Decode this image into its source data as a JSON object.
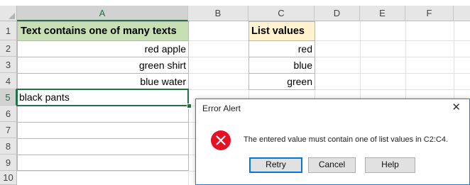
{
  "columns": [
    "A",
    "B",
    "C",
    "D",
    "E",
    "F"
  ],
  "rows": [
    "1",
    "2",
    "3",
    "4",
    "5",
    "6",
    "7",
    "8",
    "9",
    "10"
  ],
  "cells": {
    "A1": "Text contains one of many texts",
    "A2": "red apple",
    "A3": "green shirt",
    "A4": "blue water",
    "A5": "black pants",
    "C1": "List values",
    "C2": "red",
    "C3": "blue",
    "C4": "green"
  },
  "colors": {
    "header_green": "#c6e0b4",
    "header_yellow": "#fff2cc",
    "excel_green": "#217346",
    "dialog_border": "#2b79d0",
    "error_red": "#e81123"
  },
  "dialog": {
    "title": "Error Alert",
    "close_icon": "close-icon",
    "icon": "error-icon",
    "message": "The entered value must contain one of list values in C2:C4.",
    "buttons": {
      "retry": "Retry",
      "cancel": "Cancel",
      "help": "Help"
    }
  }
}
